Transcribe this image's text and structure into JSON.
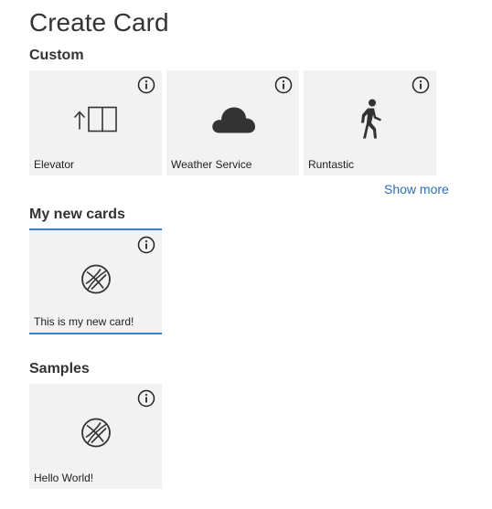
{
  "page": {
    "title": "Create Card"
  },
  "custom": {
    "heading": "Custom",
    "cards": [
      {
        "label": "Elevator",
        "icon": "elevator-icon"
      },
      {
        "label": "Weather Service",
        "icon": "cloud-icon"
      },
      {
        "label": "Runtastic",
        "icon": "walking-person-icon"
      }
    ],
    "show_more": "Show more"
  },
  "my_new_cards": {
    "heading": "My new cards",
    "cards": [
      {
        "label": "This is my new card!",
        "icon": "globe-icon"
      }
    ]
  },
  "samples": {
    "heading": "Samples",
    "cards": [
      {
        "label": "Hello World!",
        "icon": "globe-icon"
      }
    ]
  },
  "colors": {
    "card_background": "#f2f2f2",
    "selected_border": "#3b7fc4",
    "link": "#2a6ebb",
    "text": "#333333"
  }
}
